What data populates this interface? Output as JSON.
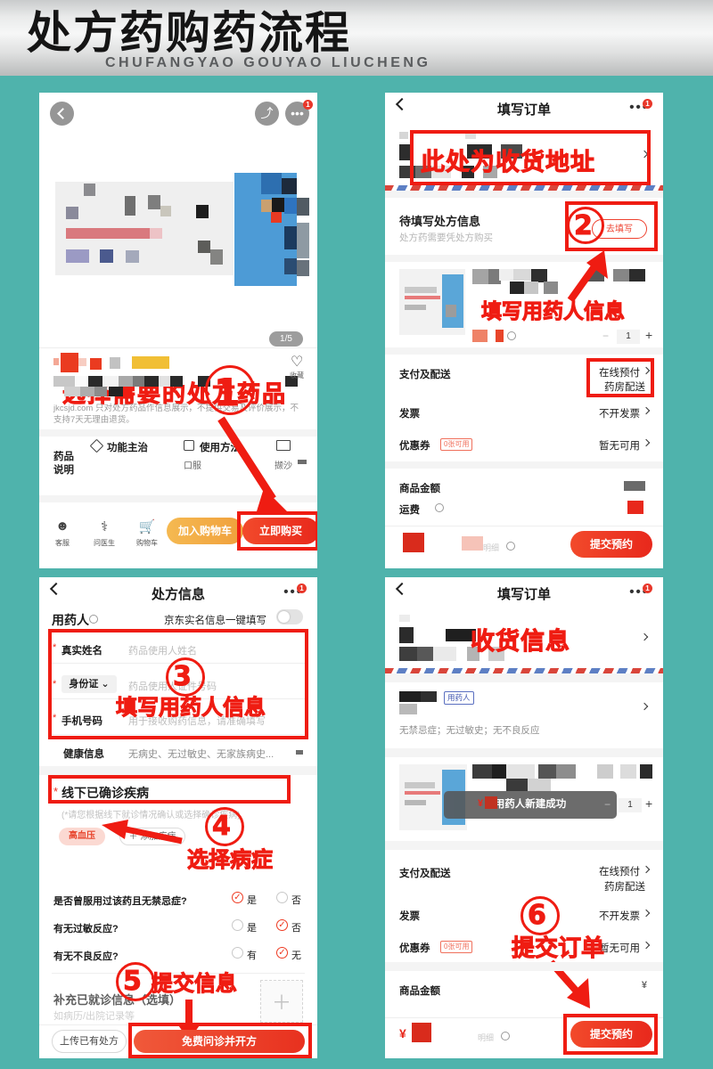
{
  "banner": {
    "title": "处方药购药流程",
    "subtitle": "CHUFANGYAO GOUYAO LIUCHENG",
    "bg_color": "#e9eaea",
    "page_bg_color": "#4fb3ac",
    "annotation_color": "#ef1c12"
  },
  "panel1": {
    "appbar": {
      "back": "‹",
      "share_icon": "share-icon",
      "more_icon": "more-icon",
      "badge": "1"
    },
    "annotation_caption": "选择需要的处方药品",
    "page_indicator": "1/5",
    "favorite_label": "收藏",
    "disclaimer": "jkcsjd.com 只对处方药品作信息展示，不提供交易及评价展示，不支持7天无理由退货。",
    "spec_title": "药品\n说明",
    "spec_title_l1": "药品",
    "spec_title_l2": "说明",
    "specs": [
      {
        "label": "功能主治",
        "value": ""
      },
      {
        "label": "使用方法",
        "value": "口服"
      },
      {
        "label": "",
        "value": "撷沙"
      }
    ],
    "tabs": [
      {
        "icon": "customer-service-icon",
        "glyph": "☻",
        "label": "客服"
      },
      {
        "icon": "doctor-icon",
        "glyph": "⚕",
        "label": "问医生"
      },
      {
        "icon": "cart-icon",
        "glyph": "🛒",
        "label": "购物车"
      }
    ],
    "add_cart_label": "加入购物车",
    "buy_now_label": "立即购买",
    "step": "①"
  },
  "panel2": {
    "appbar": {
      "title": "填写订单",
      "badge": "1"
    },
    "address_annotation": "此处为收货地址",
    "prescription_title": "待填写处方信息",
    "prescription_sub": "处方药需要凭处方购买",
    "fill_button": "去填写",
    "step_fill": "②",
    "fill_annotation": "填写用药人信息",
    "quantity": "1",
    "rows": [
      {
        "label": "支付及配送",
        "value_line1": "在线预付",
        "value_line2": "药房配送"
      },
      {
        "label": "发票",
        "value_line1": "不开发票",
        "value_line2": ""
      },
      {
        "label": "优惠券",
        "tag": "0张可用",
        "value_line1": "暂无可用",
        "value_line2": ""
      }
    ],
    "amount_label": "商品金额",
    "freight_label": "运费",
    "detail_label": "明细",
    "submit_label": "提交预约"
  },
  "panel3": {
    "appbar": {
      "title": "处方信息",
      "badge": "1"
    },
    "section_user": "用药人",
    "autofill_label": "京东实名信息一键填写",
    "autofill_on": false,
    "fields": [
      {
        "label": "真实姓名",
        "placeholder": "药品使用人姓名",
        "required": true
      },
      {
        "label": "身份证",
        "placeholder": "药品使用人证件号码",
        "required": true,
        "is_select": true
      },
      {
        "label": "手机号码",
        "placeholder": "用于接收购药信息，请准确填写",
        "required": true
      }
    ],
    "health_label": "健康信息",
    "health_value": "无病史、无过敏史、无家族病史...",
    "diagnosed_label": "线下已确诊疾病",
    "diagnosed_hint": "(*请您根据线下就诊情况确认或选择确诊疾病)",
    "disease_tag": "高血压",
    "add_disease": "＋ 添加疾病",
    "questions": [
      {
        "text": "是否曾服用过该药且无禁忌症?",
        "options": [
          "是",
          "否"
        ],
        "selected": 0
      },
      {
        "text": "有无过敏反应?",
        "options": [
          "是",
          "否"
        ],
        "selected": 1
      },
      {
        "text": "有无不良反应?",
        "options": [
          "有",
          "无"
        ],
        "selected": 1
      }
    ],
    "supplement_label": "补充已就诊信息（选填）",
    "supplement_hint": "如病历/出院记录等",
    "upload_label": "上传已有处方",
    "submit_label": "免费问诊并开方",
    "step_fill": "③",
    "annotation_fill": "填写用药人信息",
    "step_disease": "④",
    "annotation_disease": "选择病症",
    "step_submit": "⑤",
    "annotation_submit": "提交信息"
  },
  "panel4": {
    "appbar": {
      "title": "填写订单",
      "badge": "1"
    },
    "address_annotation": "收货信息",
    "user_tag": "用药人",
    "user_summary": "无禁忌症；无过敏史；无不良反应",
    "toast": "用药人新建成功",
    "quantity": "1",
    "rows": [
      {
        "label": "支付及配送",
        "value_line1": "在线预付",
        "value_line2": "药房配送"
      },
      {
        "label": "发票",
        "value_line1": "不开发票",
        "value_line2": ""
      },
      {
        "label": "优惠券",
        "tag": "0张可用",
        "value_line1": "暂无可用",
        "value_line2": ""
      }
    ],
    "amount_label": "商品金额",
    "detail_label": "明细",
    "currency": "¥",
    "submit_label": "提交预约",
    "step_submit": "⑥",
    "annotation_submit": "提交订单"
  }
}
